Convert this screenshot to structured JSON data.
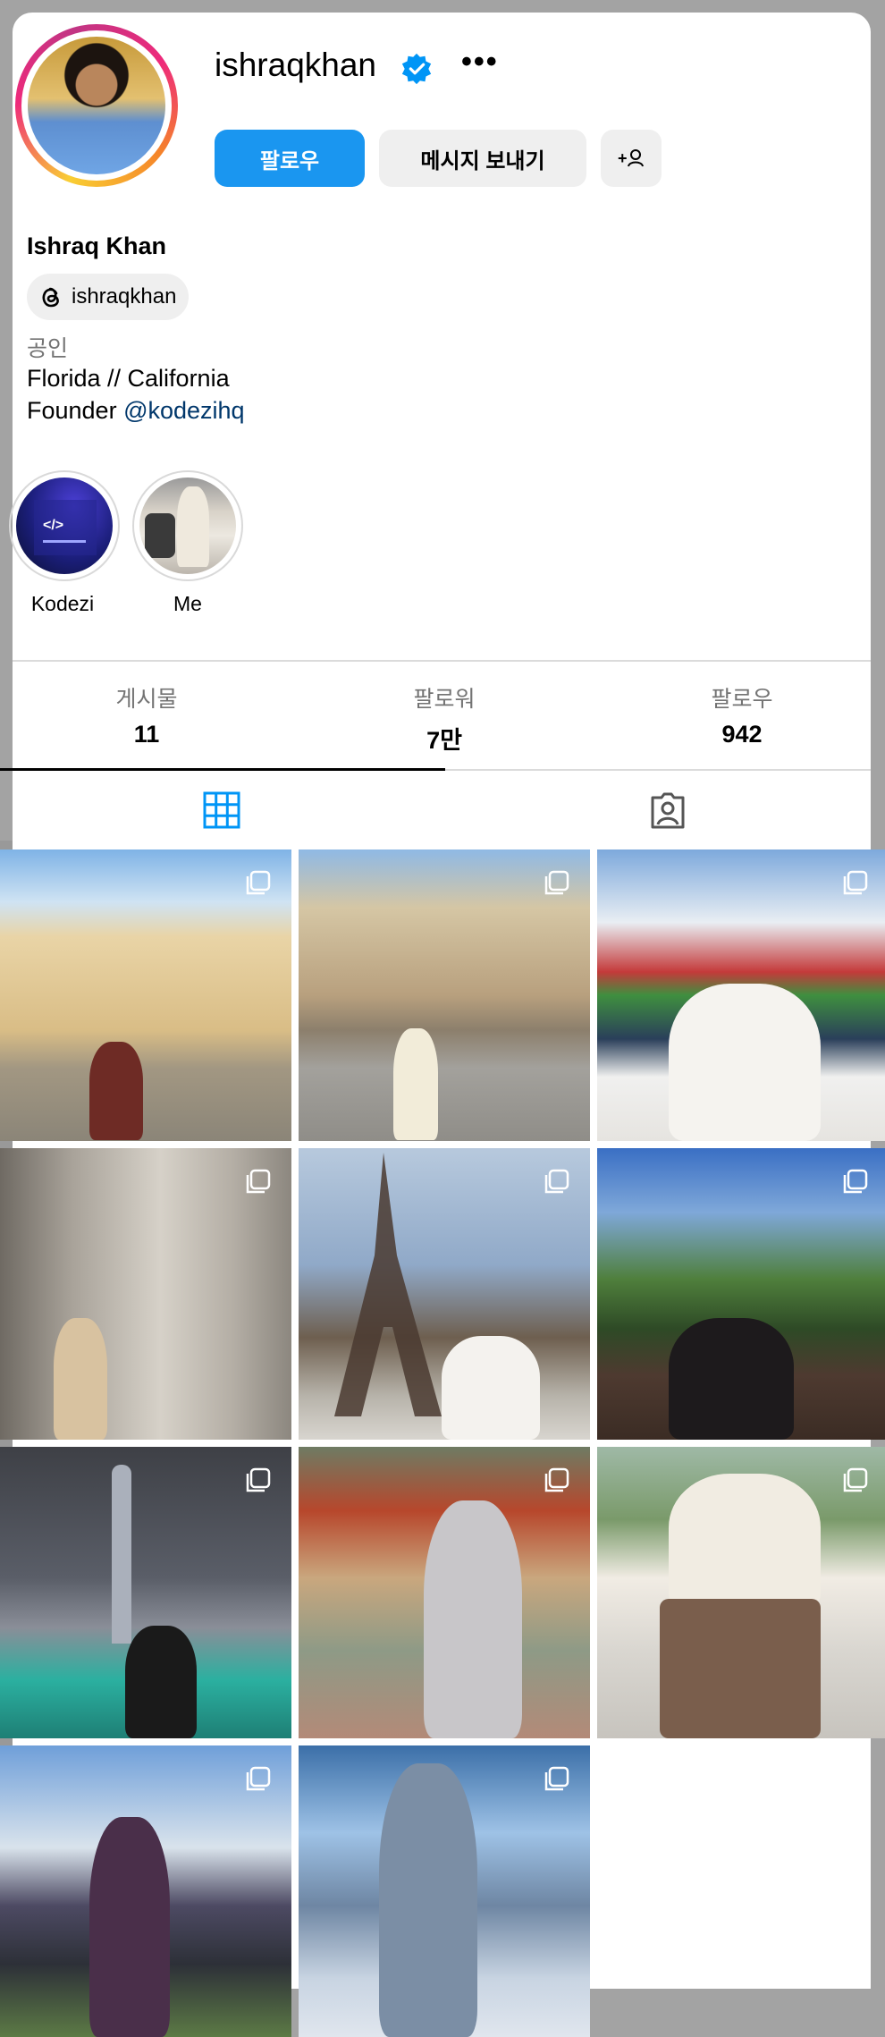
{
  "profile": {
    "username": "ishraqkhan",
    "more_icon": "•••",
    "full_name": "Ishraq Khan",
    "threads_handle": "ishraqkhan",
    "category": "공인",
    "bio_line1": "Florida // California",
    "bio_line2_prefix": "Founder ",
    "bio_mention": "@kodezihq"
  },
  "actions": {
    "follow_label": "팔로우",
    "message_label": "메시지 보내기",
    "add_label": "+♀"
  },
  "highlights": [
    {
      "label": "Kodezi"
    },
    {
      "label": "Me"
    }
  ],
  "stats": {
    "posts_label": "게시물",
    "posts_value": "11",
    "followers_label": "팔로워",
    "followers_value": "7만",
    "following_label": "팔로우",
    "following_value": "942"
  },
  "tabs": [
    {
      "icon": "grid-icon",
      "active": true
    },
    {
      "icon": "tagged-icon",
      "active": false
    }
  ],
  "colors": {
    "follow_button": "#1a96f0",
    "verified_badge": "#0095f6",
    "mention": "#00376b"
  },
  "posts_count": 11
}
